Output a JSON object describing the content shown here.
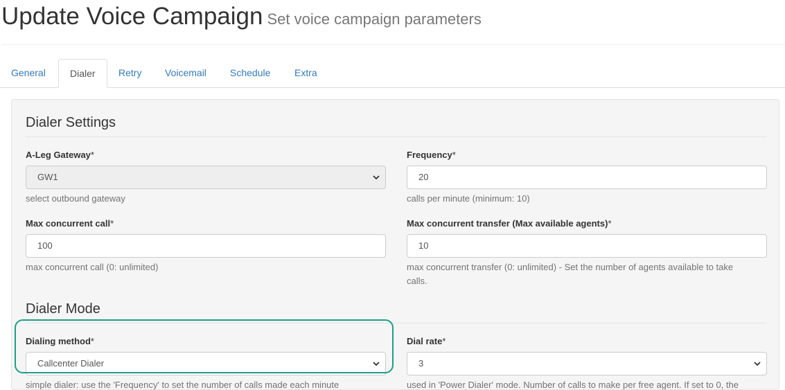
{
  "header": {
    "title": "Update Voice Campaign",
    "subtitle": "Set voice campaign parameters"
  },
  "tabs": [
    {
      "label": "General",
      "active": false
    },
    {
      "label": "Dialer",
      "active": true
    },
    {
      "label": "Retry",
      "active": false
    },
    {
      "label": "Voicemail",
      "active": false
    },
    {
      "label": "Schedule",
      "active": false
    },
    {
      "label": "Extra",
      "active": false
    }
  ],
  "dialer_settings": {
    "legend": "Dialer Settings",
    "aleg_gateway": {
      "label": "A-Leg Gateway",
      "required": "*",
      "value": "GW1",
      "help": "select outbound gateway"
    },
    "frequency": {
      "label": "Frequency",
      "required": "*",
      "value": "20",
      "help": "calls per minute (minimum: 10)"
    },
    "max_concurrent_call": {
      "label": "Max concurrent call",
      "required": "*",
      "value": "100",
      "help": "max concurrent call (0: unlimited)"
    },
    "max_concurrent_transfer": {
      "label": "Max concurrent transfer (Max available agents)",
      "required": "*",
      "value": "10",
      "help_line1": "max concurrent transfer (0: unlimited) - Set the number of agents available to take",
      "help_line2": "calls."
    }
  },
  "dialer_mode": {
    "legend": "Dialer Mode",
    "dialing_method": {
      "label": "Dialing method",
      "required": "*",
      "value": "Callcenter Dialer",
      "help_partial": "simple dialer: use the 'Frequency' to set the number of calls made each minute"
    },
    "dial_rate": {
      "label": "Dial rate",
      "required": "*",
      "value": "3",
      "help_partial": "used in 'Power Dialer' mode. Number of calls to make per free agent. If set to 0, the"
    }
  },
  "colors": {
    "highlight": "#1e9e86",
    "link": "#337ab7"
  }
}
